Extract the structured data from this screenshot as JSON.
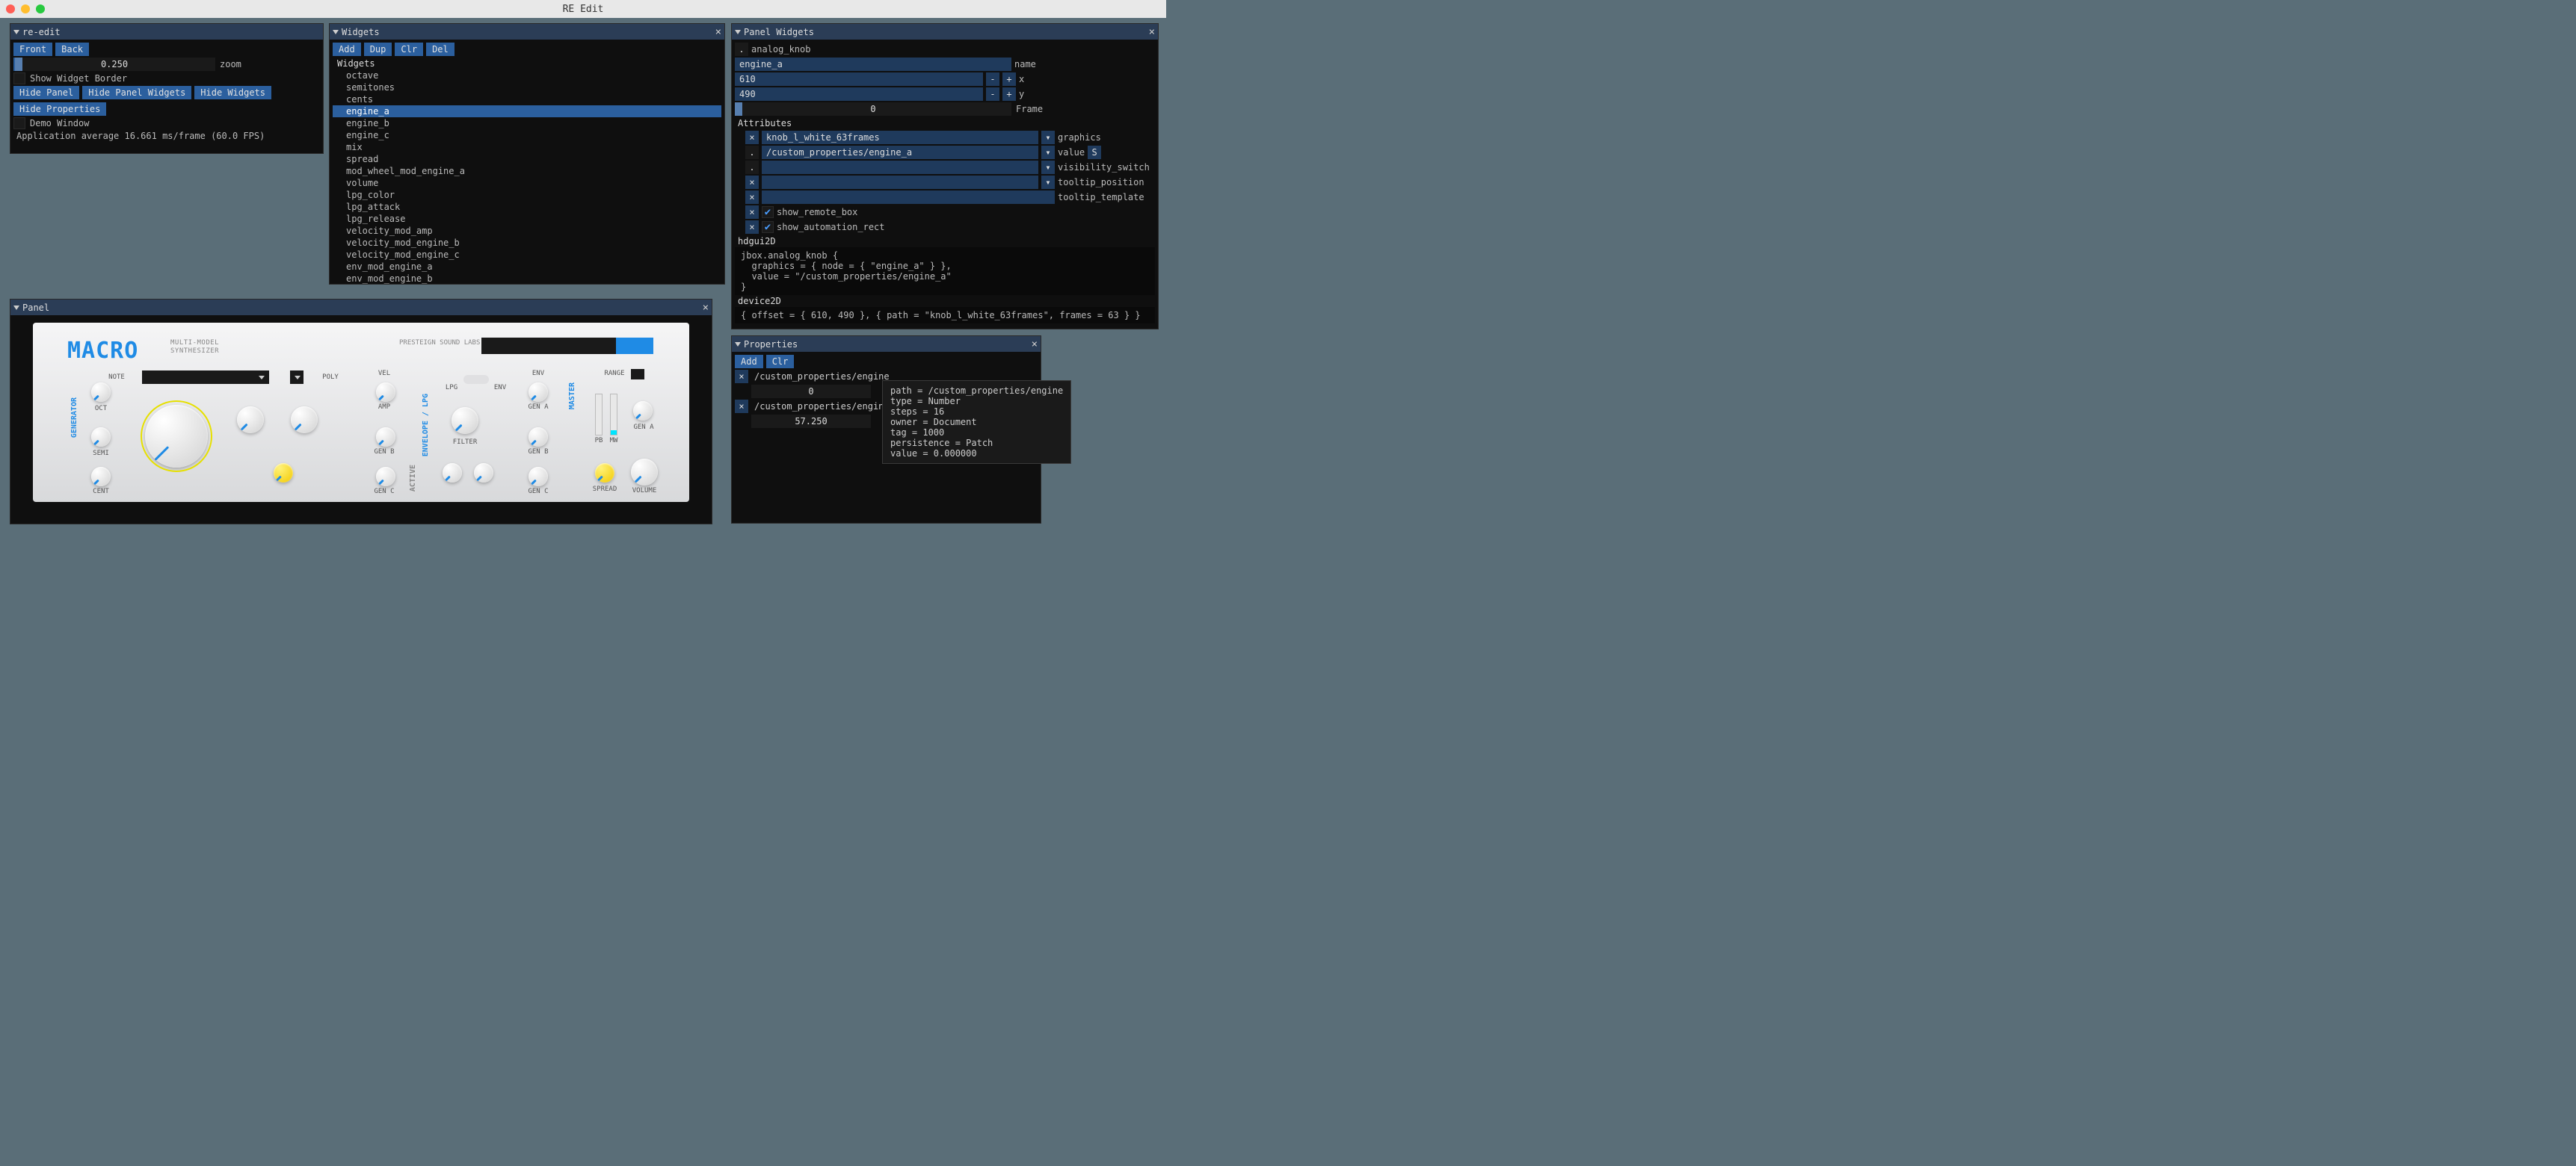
{
  "app": {
    "title": "RE Edit"
  },
  "reedit": {
    "title": "re-edit",
    "front": "Front",
    "back": "Back",
    "zoom_value": "0.250",
    "zoom_label": "zoom",
    "show_widget_border": "Show Widget Border",
    "hide_panel": "Hide Panel",
    "hide_panel_widgets": "Hide Panel Widgets",
    "hide_widgets": "Hide Widgets",
    "hide_properties": "Hide Properties",
    "demo_window": "Demo Window",
    "status": "Application average 16.661 ms/frame (60.0 FPS)"
  },
  "widgets": {
    "title": "Widgets",
    "add": "Add",
    "dup": "Dup",
    "clr": "Clr",
    "del": "Del",
    "root": "Widgets",
    "items": [
      "octave",
      "semitones",
      "cents",
      "engine_a",
      "engine_b",
      "engine_c",
      "mix",
      "spread",
      "mod_wheel_mod_engine_a",
      "volume",
      "lpg_color",
      "lpg_attack",
      "lpg_release",
      "velocity_mod_amp",
      "velocity_mod_engine_b",
      "velocity_mod_engine_c",
      "env_mod_engine_a",
      "env_mod_engine_b"
    ],
    "selected_index": 3
  },
  "panel_widgets": {
    "title": "Panel Widgets",
    "type": "analog_knob",
    "name_label": "name",
    "name_value": "engine_a",
    "x_label": "x",
    "x_value": "610",
    "y_label": "y",
    "y_value": "490",
    "frame_label": "Frame",
    "frame_value": "0",
    "attr_header": "Attributes",
    "attr_graphics": "knob_l_white_63frames",
    "attr_graphics_label": "graphics",
    "attr_value": "/custom_properties/engine_a",
    "attr_value_label": "value",
    "attr_s": "S",
    "attr_visibility_label": "visibility_switch",
    "attr_tooltip_pos_label": "tooltip_position",
    "attr_tooltip_tpl_label": "tooltip_template",
    "attr_show_remote": "show_remote_box",
    "attr_show_automation": "show_automation_rect",
    "hdgui_header": "hdgui2D",
    "hdgui_code": "jbox.analog_knob {\n  graphics = { node = { \"engine_a\" } },\n  value = \"/custom_properties/engine_a\"\n}",
    "device_header": "device2D",
    "device_code": "{ offset = { 610, 490 }, { path = \"knob_l_white_63frames\", frames = 63 } }"
  },
  "properties": {
    "title": "Properties",
    "add": "Add",
    "clr": "Clr",
    "rows": [
      {
        "path": "/custom_properties/engine",
        "value": "0"
      },
      {
        "path": "/custom_properties/engine_a",
        "value": "57.250"
      }
    ],
    "tooltip": "path = /custom_properties/engine\ntype = Number\nsteps = 16\nowner = Document\ntag = 1000\npersistence = Patch\nvalue = 0.000000"
  },
  "panel": {
    "title": "Panel",
    "logo": "MACRO",
    "sub1": "MULTI-MODEL",
    "sub2": "SYNTHESIZER",
    "brand": "PRESTEIGN\nSOUND\nLABS",
    "note": "NOTE",
    "poly": "POLY",
    "generator": "GENERATOR",
    "oct": "OCT",
    "semi": "SEMI",
    "cent": "CENT",
    "vel": "VEL",
    "amp": "AMP",
    "genb": "GEN B",
    "genc": "GEN C",
    "env_label": "ENVELOPE / LPG",
    "active": "ACTIVE",
    "lpg": "LPG",
    "env": "ENV",
    "filter": "FILTER",
    "env2": "ENV",
    "gena2": "GEN A",
    "genb2": "GEN B",
    "genc2": "GEN C",
    "master": "MASTER",
    "range": "RANGE",
    "pb": "PB",
    "mw": "MW",
    "gena3": "GEN A",
    "spread": "SPREAD",
    "volume": "VOLUME"
  }
}
